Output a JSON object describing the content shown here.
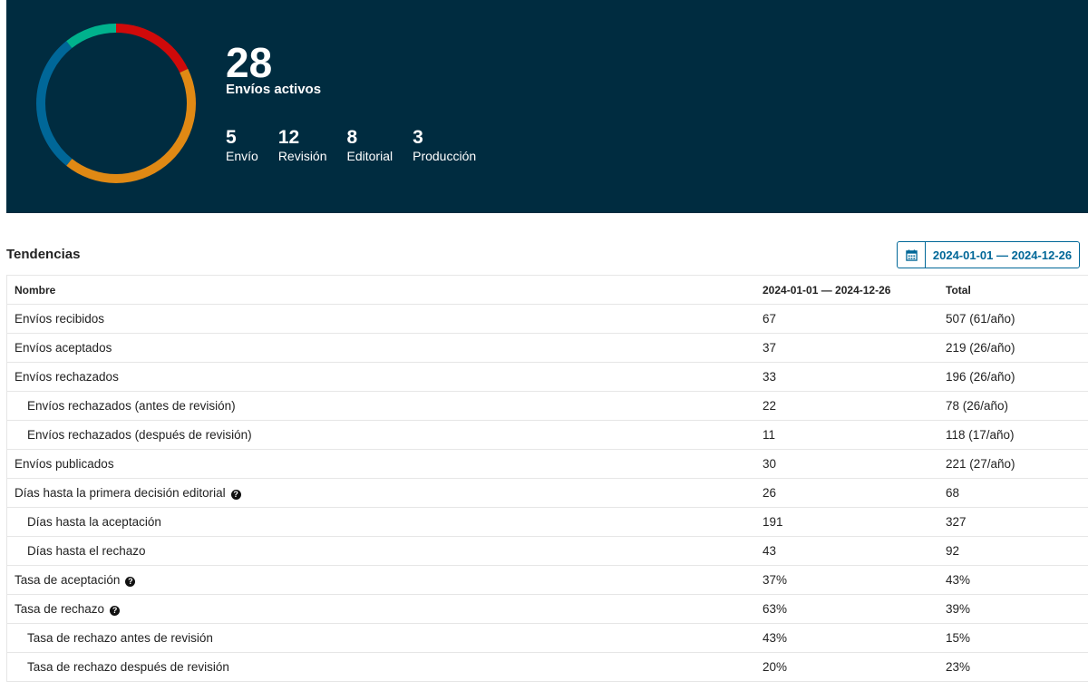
{
  "summary": {
    "total": "28",
    "total_label": "Envíos activos",
    "stages": [
      {
        "count": "5",
        "label": "Envío",
        "color": "#d00a0a"
      },
      {
        "count": "12",
        "label": "Revisión",
        "color": "#e08914"
      },
      {
        "count": "8",
        "label": "Editorial",
        "color": "#006798"
      },
      {
        "count": "3",
        "label": "Producción",
        "color": "#00b28d"
      }
    ]
  },
  "trends": {
    "title": "Tendencias",
    "date_range": "2024-01-01 — 2024-12-26",
    "headers": {
      "name": "Nombre",
      "range": "2024-01-01 — 2024-12-26",
      "total": "Total"
    },
    "rows": [
      {
        "name": "Envíos recibidos",
        "range": "67",
        "total": "507 (61/año)"
      },
      {
        "name": "Envíos aceptados",
        "range": "37",
        "total": "219 (26/año)"
      },
      {
        "name": "Envíos rechazados",
        "range": "33",
        "total": "196 (26/año)"
      },
      {
        "name": "Envíos rechazados (antes de revisión)",
        "range": "22",
        "total": "78 (26/año)"
      },
      {
        "name": "Envíos rechazados (después de revisión)",
        "range": "11",
        "total": "118 (17/año)"
      },
      {
        "name": "Envíos publicados",
        "range": "30",
        "total": "221 (27/año)"
      },
      {
        "name": "Días hasta la primera decisión editorial",
        "range": "26",
        "total": "68"
      },
      {
        "name": "Días hasta la aceptación",
        "range": "191",
        "total": "327"
      },
      {
        "name": "Días hasta el rechazo",
        "range": "43",
        "total": "92"
      },
      {
        "name": "Tasa de aceptación",
        "range": "37%",
        "total": "43%"
      },
      {
        "name": "Tasa de rechazo",
        "range": "63%",
        "total": "39%"
      },
      {
        "name": "Tasa de rechazo antes de revisión",
        "range": "43%",
        "total": "15%"
      },
      {
        "name": "Tasa de rechazo después de revisión",
        "range": "20%",
        "total": "23%"
      }
    ]
  },
  "icons": {
    "calendar": "calendar-icon",
    "help": "question-circle-icon"
  }
}
